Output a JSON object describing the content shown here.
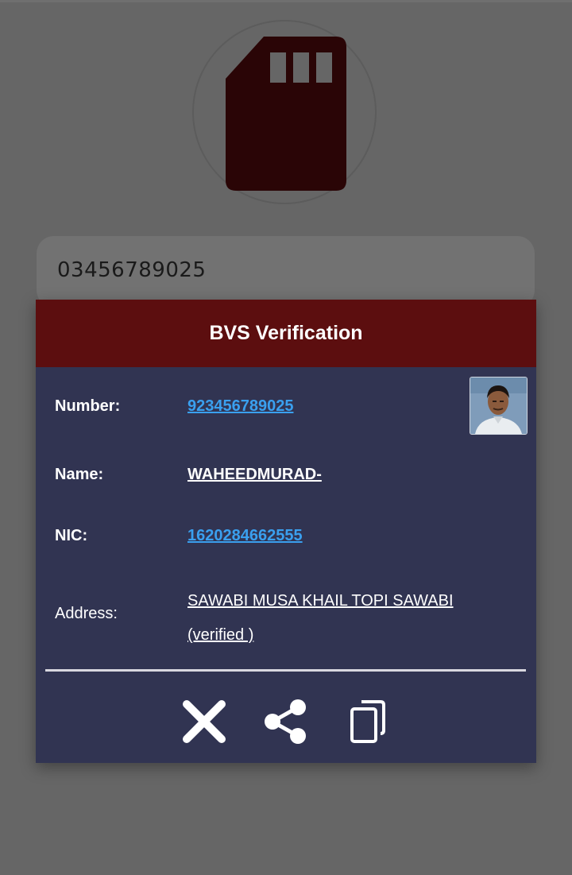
{
  "phone_input": {
    "value": "03456789025"
  },
  "dialog": {
    "title": "BVS Verification",
    "rows": [
      {
        "label": "Number:",
        "value": "923456789025"
      },
      {
        "label": "Name:",
        "value": "WAHEEDMURAD-"
      },
      {
        "label": "NIC:",
        "value": "1620284662555"
      },
      {
        "label": "Address:",
        "value_line1": "SAWABI MUSA KHAIL TOPI SAWABI",
        "value_line2": "(verified )"
      }
    ],
    "actions": [
      {
        "icon": "close-icon"
      },
      {
        "icon": "share-icon"
      },
      {
        "icon": "copy-icon"
      }
    ]
  },
  "colors": {
    "header_bg": "#5c0e0f",
    "dialog_bg": "#313452",
    "link_blue": "#3aa0ef",
    "sim_icon": "#2a0506",
    "overlay": "#666666"
  }
}
